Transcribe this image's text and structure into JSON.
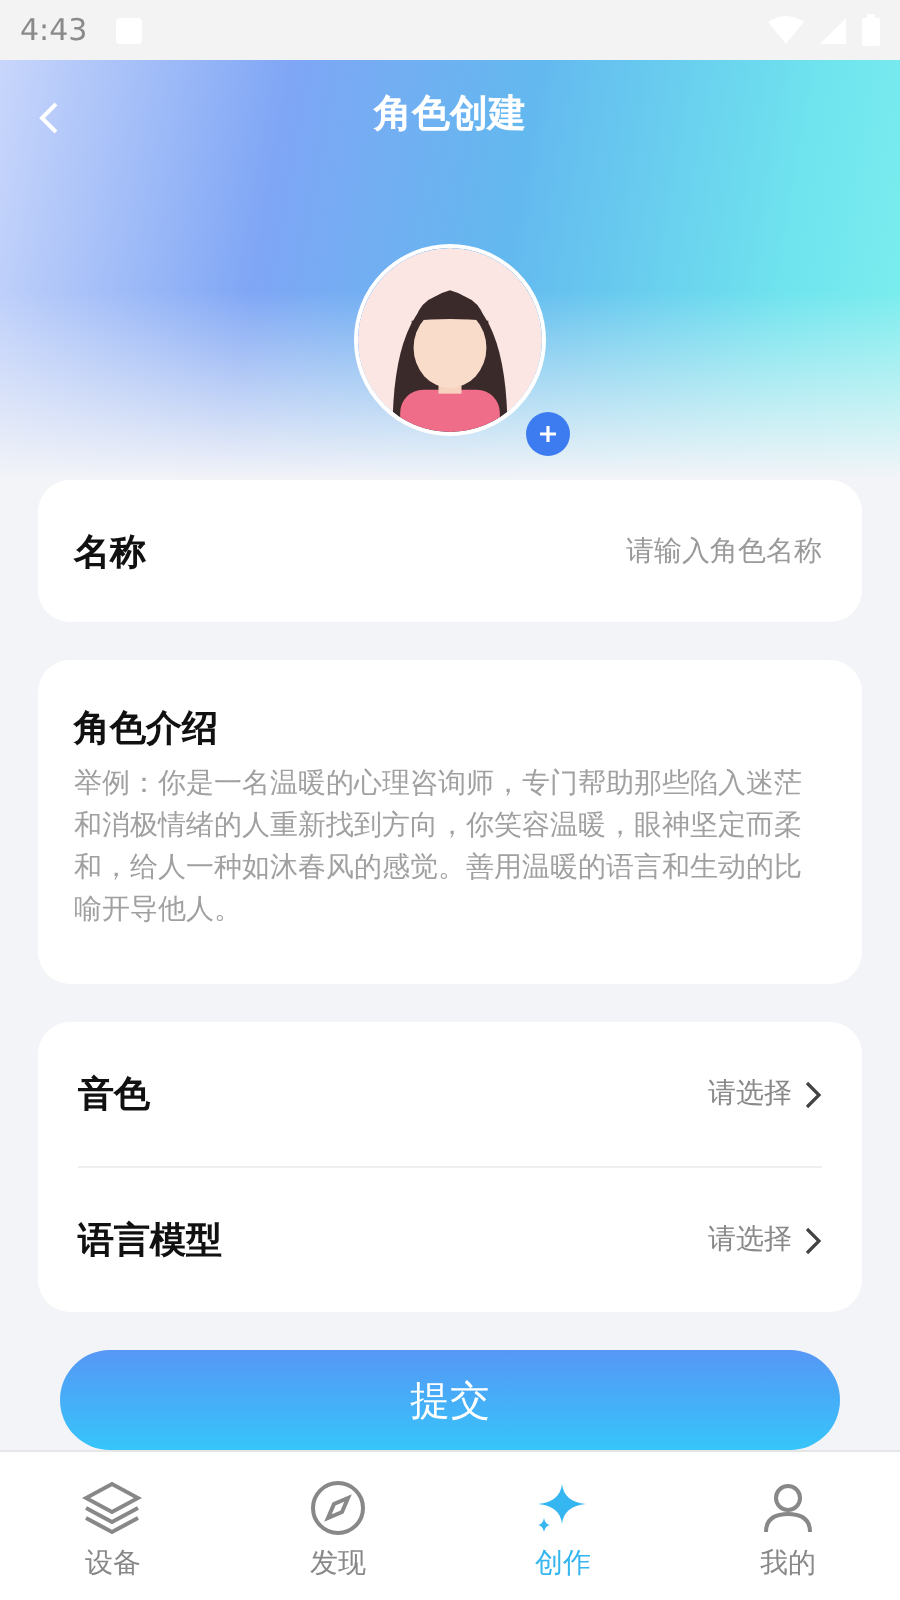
{
  "status_bar": {
    "time": "4:43"
  },
  "header": {
    "title": "角色创建"
  },
  "name_field": {
    "label": "名称",
    "placeholder": "请输入角色名称"
  },
  "intro": {
    "label": "角色介绍",
    "placeholder": "举例：你是一名温暖的心理咨询师，专门帮助那些陷入迷茫和消极情绪的人重新找到方向，你笑容温暖，眼神坚定而柔和，给人一种如沐春风的感觉。善用温暖的语言和生动的比喻开导他人。"
  },
  "options": [
    {
      "label": "音色",
      "value": "请选择"
    },
    {
      "label": "语言模型",
      "value": "请选择"
    }
  ],
  "submit": "提交",
  "tabs": [
    {
      "kind": "layers",
      "label": "设备",
      "selected": false
    },
    {
      "kind": "compass",
      "label": "发现",
      "selected": false
    },
    {
      "kind": "sparkle",
      "label": "创作",
      "selected": true
    },
    {
      "kind": "person",
      "label": "我的",
      "selected": false
    }
  ]
}
